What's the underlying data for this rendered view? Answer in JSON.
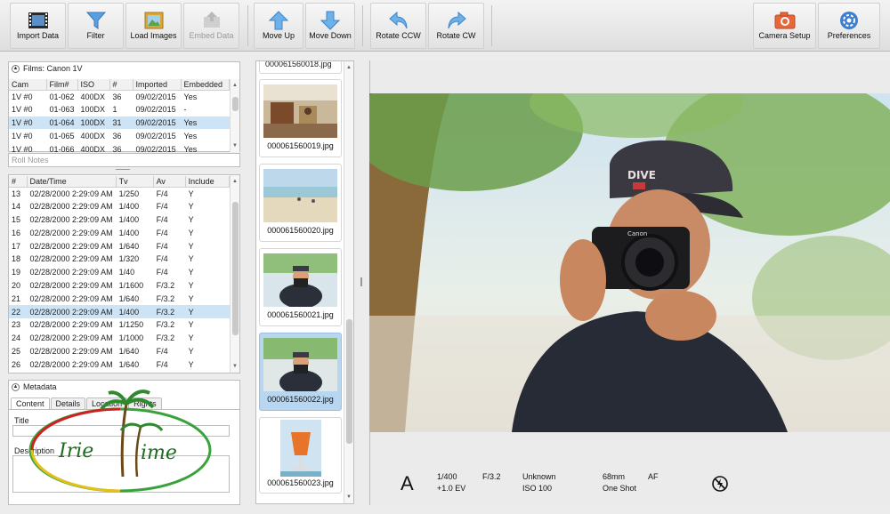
{
  "toolbar": {
    "import_label": "Import Data",
    "filter_label": "Filter",
    "load_images_label": "Load Images",
    "embed_data_label": "Embed Data",
    "move_up_label": "Move Up",
    "move_down_label": "Move Down",
    "rotate_ccw_label": "Rotate CCW",
    "rotate_cw_label": "Rotate CW",
    "camera_setup_label": "Camera Setup",
    "preferences_label": "Preferences"
  },
  "films": {
    "title": "Films: Canon 1V",
    "headers": [
      "Cam",
      "Film#",
      "ISO",
      "#",
      "Imported",
      "Embedded"
    ],
    "rows": [
      [
        "1V #0",
        "01-062",
        "400DX",
        "36",
        "09/02/2015",
        "Yes"
      ],
      [
        "1V #0",
        "01-063",
        "100DX",
        "1",
        "09/02/2015",
        "-"
      ],
      [
        "1V #0",
        "01-064",
        "100DX",
        "31",
        "09/02/2015",
        "Yes"
      ],
      [
        "1V #0",
        "01-065",
        "400DX",
        "36",
        "09/02/2015",
        "Yes"
      ],
      [
        "1V #0",
        "01-066",
        "400DX",
        "36",
        "09/02/2015",
        "Yes"
      ]
    ],
    "selected_index": 2
  },
  "roll_notes_placeholder": "Roll Notes",
  "frames": {
    "headers": [
      "#",
      "Date/Time",
      "Tv",
      "Av",
      "Include"
    ],
    "rows": [
      [
        "13",
        "02/28/2000 2:29:09 AM",
        "1/250",
        "F/4",
        "Y"
      ],
      [
        "14",
        "02/28/2000 2:29:09 AM",
        "1/400",
        "F/4",
        "Y"
      ],
      [
        "15",
        "02/28/2000 2:29:09 AM",
        "1/400",
        "F/4",
        "Y"
      ],
      [
        "16",
        "02/28/2000 2:29:09 AM",
        "1/400",
        "F/4",
        "Y"
      ],
      [
        "17",
        "02/28/2000 2:29:09 AM",
        "1/640",
        "F/4",
        "Y"
      ],
      [
        "18",
        "02/28/2000 2:29:09 AM",
        "1/320",
        "F/4",
        "Y"
      ],
      [
        "19",
        "02/28/2000 2:29:09 AM",
        "1/40",
        "F/4",
        "Y"
      ],
      [
        "20",
        "02/28/2000 2:29:09 AM",
        "1/1600",
        "F/3.2",
        "Y"
      ],
      [
        "21",
        "02/28/2000 2:29:09 AM",
        "1/640",
        "F/3.2",
        "Y"
      ],
      [
        "22",
        "02/28/2000 2:29:09 AM",
        "1/400",
        "F/3.2",
        "Y"
      ],
      [
        "23",
        "02/28/2000 2:29:09 AM",
        "1/1250",
        "F/3.2",
        "Y"
      ],
      [
        "24",
        "02/28/2000 2:29:09 AM",
        "1/1000",
        "F/3.2",
        "Y"
      ],
      [
        "25",
        "02/28/2000 2:29:09 AM",
        "1/640",
        "F/4",
        "Y"
      ],
      [
        "26",
        "02/28/2000 2:29:09 AM",
        "1/640",
        "F/4",
        "Y"
      ]
    ],
    "selected_index": 9
  },
  "metadata": {
    "title": "Metadata",
    "tabs": [
      "Content",
      "Details",
      "Location",
      "Rights"
    ],
    "title_label": "Title",
    "description_label": "Description",
    "watermark_text": "Irie Time"
  },
  "filmstrip": {
    "top_partial": "000061560018.jpg",
    "items": [
      {
        "name": "000061560019.jpg",
        "scene": "bar"
      },
      {
        "name": "000061560020.jpg",
        "scene": "beach"
      },
      {
        "name": "000061560021.jpg",
        "scene": "photographer"
      },
      {
        "name": "000061560022.jpg",
        "scene": "photographer"
      },
      {
        "name": "000061560023.jpg",
        "scene": "drink"
      }
    ],
    "selected_index": 3
  },
  "shot_info": {
    "mode": "A",
    "shutter": "1/400",
    "exposure_comp": "+1.0 EV",
    "aperture": "F/3.2",
    "metering": "Unknown",
    "iso": "ISO 100",
    "focal_length": "68mm",
    "drive": "One Shot",
    "focus": "AF",
    "flash_icon": "flash-off-icon"
  },
  "colors": {
    "selection": "#cde4f6",
    "thumb_selection": "#b8d6f0",
    "icon_blue": "#4a90d9",
    "icon_orange": "#e8663a"
  }
}
